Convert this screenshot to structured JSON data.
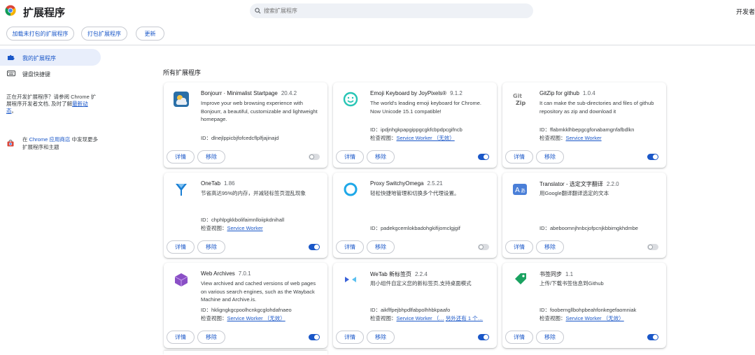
{
  "header": {
    "title": "扩展程序",
    "search_placeholder": "搜索扩展程序",
    "dev_mode_label": "开发者"
  },
  "toolbar": {
    "load_unpacked": "加载未打包的扩展程序",
    "pack": "打包扩展程序",
    "update": "更新"
  },
  "sidebar": {
    "items": [
      {
        "label": "我的扩展程序",
        "active": true
      },
      {
        "label": "键盘快捷键",
        "active": false
      }
    ],
    "dev_note_prefix": "正在开发扩展程序？请参阅 Chrome 扩展程序开发者文档, 及时了解",
    "dev_note_link": "最新动态",
    "dev_note_suffix": "。",
    "store_prefix": "在",
    "store_link": "Chrome 应用商店",
    "store_suffix": "中发现更多扩展程序和主题"
  },
  "section_title": "所有扩展程序",
  "details_label": "详情",
  "remove_label": "移除",
  "extensions": [
    {
      "name": "Bonjourr · Minimalist Startpage",
      "version": "20.4.2",
      "description": "Improve your web browsing experience with Bonjourr, a beautiful, customizable and lightweight homepage.",
      "id": "ID：dlnejlppicbjfofcedcflplfjajinajd",
      "view_label": "",
      "view_link": "",
      "view_extra": "",
      "enabled": false,
      "icon": "bonjourr-icon",
      "color": "#2a6fa8"
    },
    {
      "name": "Emoji Keyboard by JoyPixels®",
      "version": "9.1.2",
      "description": "The world's leading emoji keyboard for Chrome. Now Unicode 15.1 compatible!",
      "id": "ID：ipdjnhgkpapgippgcgkfcbpdpcgifncb",
      "view_label": "检查视图：",
      "view_link": "Service Worker （无效）",
      "view_extra": "",
      "enabled": true,
      "icon": "emoji-icon",
      "color": "#27c5b5"
    },
    {
      "name": "GitZip for github",
      "version": "1.0.4",
      "description": "It can make the sub-directories and files of github repository as zip and download it",
      "id": "ID：ffabmkklhbepgcgfonabamgnfafbdlkn",
      "view_label": "检查视图：",
      "view_link": "Service Worker",
      "view_extra": "",
      "enabled": true,
      "icon": "gitzip-icon",
      "color": "#666666"
    },
    {
      "name": "OneTab",
      "version": "1.86",
      "description": "节省高达95%的内存，并减轻标签页混乱现象",
      "id": "ID：chphlpgkkbolifaimnlloiipkdnihall",
      "view_label": "检查视图：",
      "view_link": "Service Worker",
      "view_extra": "",
      "enabled": true,
      "icon": "onetab-icon",
      "color": "#1a7fd4"
    },
    {
      "name": "Proxy SwitchyOmega",
      "version": "2.5.21",
      "description": "轻松快捷地管理和切换多个代理设置。",
      "id": "ID：padekgcemlokbadohgkifijomclgjgif",
      "view_label": "",
      "view_link": "",
      "view_extra": "",
      "enabled": false,
      "icon": "switchyomega-icon",
      "color": "#1ea8e8"
    },
    {
      "name": "Translator - 选定文字翻译",
      "version": "2.2.0",
      "description": "用Google翻译翻译选定的文本",
      "id": "ID：abeboomnjhnbcjofpcnjkbbimgkhdmbe",
      "view_label": "",
      "view_link": "",
      "view_extra": "",
      "enabled": false,
      "icon": "translator-icon",
      "color": "#4a7fd8"
    },
    {
      "name": "Web Archives",
      "version": "7.0.1",
      "description": "View archived and cached versions of web pages on various search engines, such as the Wayback Machine and Archive.is.",
      "id": "ID：hkligngkgcpoolhcnkgcglohdafnaeo",
      "view_label": "检查视图：",
      "view_link": "Service Worker （无效）",
      "view_extra": "",
      "enabled": true,
      "icon": "webarchives-icon",
      "color": "#8a4fc6"
    },
    {
      "name": "WeTab 新标签页",
      "version": "2.2.4",
      "description": "用小组件自定义您的新标签页,支持桌面模式",
      "id": "ID：aikflfpejbhpdlfabpolhhbkpaafo",
      "view_label": "检查视图：",
      "view_link": "Service Worker （…",
      "view_extra": "另外还有 1 个…",
      "enabled": true,
      "icon": "wetab-icon",
      "color": "#3a62d8"
    },
    {
      "name": "书签同步",
      "version": "1.1",
      "description": "上传/下载书签信息到Github",
      "id": "ID：fooberngllbohpbeahfonkegefaomniak",
      "view_label": "检查视图：",
      "view_link": "Service Worker （无效）",
      "view_extra": "",
      "enabled": true,
      "icon": "bookmark-sync-icon",
      "color": "#1aa260"
    }
  ]
}
